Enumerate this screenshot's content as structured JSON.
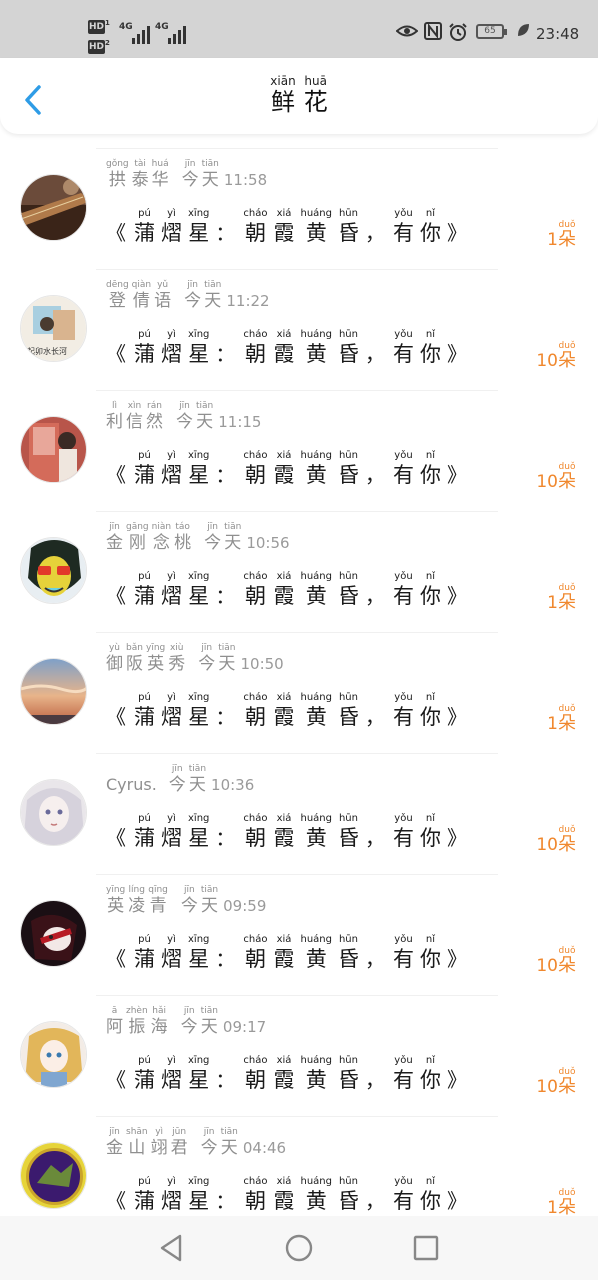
{
  "status_bar": {
    "sim1": "HD",
    "sim1_index": "1",
    "sim2": "HD",
    "sim2_index": "2",
    "network1": "4G",
    "network2": "4G",
    "battery": "65",
    "time": "23:48",
    "icons": [
      "eye-icon",
      "nfc-icon",
      "alarm-icon",
      "battery-icon",
      "leaf-icon"
    ]
  },
  "header": {
    "back_icon": "chevron-left-icon",
    "title": [
      {
        "hz": "鲜",
        "py": "xiān"
      },
      {
        "hz": "花",
        "py": "huā"
      }
    ],
    "accent": "#2e9ce6"
  },
  "song": {
    "open": "《",
    "title": [
      {
        "hz": "蒲",
        "py": "pú"
      },
      {
        "hz": "熠",
        "py": "yì"
      },
      {
        "hz": "星",
        "py": "xīng"
      }
    ],
    "colon": "：",
    "subtitle": [
      {
        "hz": "朝",
        "py": "cháo"
      },
      {
        "hz": "霞",
        "py": "xiá"
      },
      {
        "hz": "黄",
        "py": "huáng"
      },
      {
        "hz": "昏",
        "py": "hūn"
      }
    ],
    "comma": "，",
    "tail": [
      {
        "hz": "有",
        "py": "yǒu"
      },
      {
        "hz": "你",
        "py": "nǐ"
      }
    ],
    "close": "》"
  },
  "today": [
    {
      "hz": "今",
      "py": "jīn"
    },
    {
      "hz": "天",
      "py": "tiān"
    }
  ],
  "unit": {
    "hz": "朵",
    "py": "duǒ"
  },
  "count_color": "#f0882e",
  "gifts": [
    {
      "name": [
        {
          "hz": "拱",
          "py": "gǒng"
        },
        {
          "hz": "泰",
          "py": "tài"
        },
        {
          "hz": "华",
          "py": "huá"
        }
      ],
      "time": "11:58",
      "count": "1"
    },
    {
      "name": [
        {
          "hz": "登",
          "py": "dēng"
        },
        {
          "hz": "倩",
          "py": "qiàn"
        },
        {
          "hz": "语",
          "py": "yǔ"
        }
      ],
      "time": "11:22",
      "count": "10"
    },
    {
      "name": [
        {
          "hz": "利",
          "py": "lì"
        },
        {
          "hz": "信",
          "py": "xìn"
        },
        {
          "hz": "然",
          "py": "rán"
        }
      ],
      "time": "11:15",
      "count": "10"
    },
    {
      "name": [
        {
          "hz": "金",
          "py": "jīn"
        },
        {
          "hz": "刚",
          "py": "gāng"
        },
        {
          "hz": "念",
          "py": "niàn"
        },
        {
          "hz": "桃",
          "py": "táo"
        }
      ],
      "time": "10:56",
      "count": "1"
    },
    {
      "name": [
        {
          "hz": "御",
          "py": "yù"
        },
        {
          "hz": "阪",
          "py": "bǎn"
        },
        {
          "hz": "英",
          "py": "yīng"
        },
        {
          "hz": "秀",
          "py": "xiù"
        }
      ],
      "time": "10:50",
      "count": "1"
    },
    {
      "name_plain": "Cyrus.",
      "time": "10:36",
      "count": "10"
    },
    {
      "name": [
        {
          "hz": "英",
          "py": "yīng"
        },
        {
          "hz": "凌",
          "py": "líng"
        },
        {
          "hz": "青",
          "py": "qīng"
        }
      ],
      "time": "09:59",
      "count": "10"
    },
    {
      "name": [
        {
          "hz": "阿",
          "py": "ā"
        },
        {
          "hz": "振",
          "py": "zhèn"
        },
        {
          "hz": "海",
          "py": "hǎi"
        }
      ],
      "time": "09:17",
      "count": "10"
    },
    {
      "name": [
        {
          "hz": "金",
          "py": "jīn"
        },
        {
          "hz": "山",
          "py": "shān"
        },
        {
          "hz": "翊",
          "py": "yì"
        },
        {
          "hz": "君",
          "py": "jūn"
        }
      ],
      "time": "04:46",
      "count": "1"
    }
  ],
  "avatar_1_caption": "起卯水长河",
  "nav": {
    "back": "triangle-back-icon",
    "home": "circle-home-icon",
    "recents": "square-recents-icon"
  }
}
